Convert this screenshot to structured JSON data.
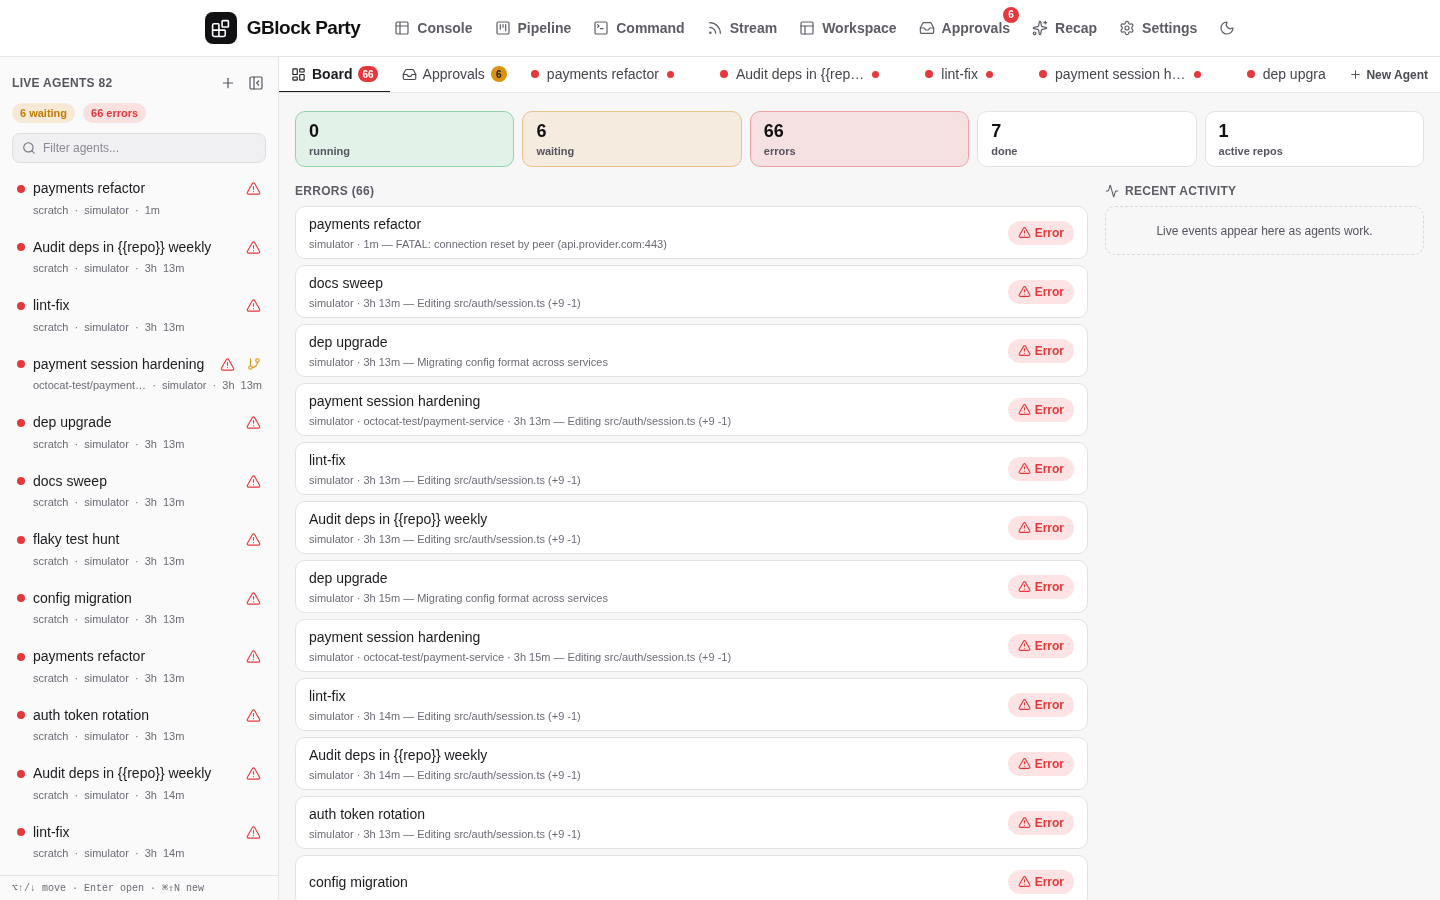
{
  "header": {
    "brand": "GBlock Party",
    "nav": [
      {
        "label": "Console"
      },
      {
        "label": "Pipeline"
      },
      {
        "label": "Command"
      },
      {
        "label": "Stream"
      },
      {
        "label": "Workspace"
      },
      {
        "label": "Approvals",
        "badge": "6"
      },
      {
        "label": "Recap"
      },
      {
        "label": "Settings"
      }
    ]
  },
  "sidebar": {
    "title": "LIVE AGENTS 82",
    "badges": [
      {
        "label": "6 waiting",
        "kind": "warning"
      },
      {
        "label": "66 errors",
        "kind": "danger"
      }
    ],
    "search": {
      "placeholder": "Filter agents..."
    },
    "agents": [
      {
        "name": "payments refactor",
        "meta": "scratch · simulator · 1m",
        "error": true,
        "branch": false
      },
      {
        "name": "Audit deps in {{repo}} weekly",
        "meta": "scratch · simulator · 3h 13m",
        "error": true,
        "branch": false
      },
      {
        "name": "lint-fix",
        "meta": "scratch · simulator · 3h 13m",
        "error": true,
        "branch": false
      },
      {
        "name": "payment session hardening",
        "meta": "octocat-test/payment… · simulator · 3h 13m",
        "error": true,
        "branch": true
      },
      {
        "name": "dep upgrade",
        "meta": "scratch · simulator · 3h 13m",
        "error": true,
        "branch": false
      },
      {
        "name": "docs sweep",
        "meta": "scratch · simulator · 3h 13m",
        "error": true,
        "branch": false
      },
      {
        "name": "flaky test hunt",
        "meta": "scratch · simulator · 3h 13m",
        "error": true,
        "branch": false
      },
      {
        "name": "config migration",
        "meta": "scratch · simulator · 3h 13m",
        "error": true,
        "branch": false
      },
      {
        "name": "payments refactor",
        "meta": "scratch · simulator · 3h 13m",
        "error": true,
        "branch": false
      },
      {
        "name": "auth token rotation",
        "meta": "scratch · simulator · 3h 13m",
        "error": true,
        "branch": false
      },
      {
        "name": "Audit deps in {{repo}} weekly",
        "meta": "scratch · simulator · 3h 14m",
        "error": true,
        "branch": false
      },
      {
        "name": "lint-fix",
        "meta": "scratch · simulator · 3h 14m",
        "error": true,
        "branch": false
      }
    ],
    "footer": "⌥↑/↓ move · Enter open · ⌘⇧N new"
  },
  "tabs": [
    {
      "kind": "board",
      "label": "Board",
      "badge": "66",
      "selected": true
    },
    {
      "kind": "approvals",
      "label": "Approvals",
      "badge": "6",
      "selected": false
    },
    {
      "kind": "agent",
      "label": "payments refactor",
      "error": true,
      "unread": true,
      "selected": false
    },
    {
      "kind": "agent",
      "label": "Audit deps in {{rep…",
      "error": true,
      "unread": true,
      "selected": false
    },
    {
      "kind": "agent",
      "label": "lint-fix",
      "error": true,
      "unread": true,
      "selected": false
    },
    {
      "kind": "agent",
      "label": "payment session h…",
      "error": true,
      "unread": true,
      "selected": false
    },
    {
      "kind": "agent",
      "label": "dep upgra",
      "error": true,
      "unread": false,
      "selected": false
    }
  ],
  "new_agent": "New Agent",
  "stats": [
    {
      "value": "0",
      "label": "running",
      "kind": "success"
    },
    {
      "value": "6",
      "label": "waiting",
      "kind": "warning"
    },
    {
      "value": "66",
      "label": "errors",
      "kind": "danger"
    },
    {
      "value": "7",
      "label": "done",
      "kind": "neutral"
    },
    {
      "value": "1",
      "label": "active repos",
      "kind": "neutral"
    }
  ],
  "errors": {
    "title": "ERRORS (66)",
    "items": [
      {
        "title": "payments refactor",
        "detail": "simulator · 1m — FATAL: connection reset by peer (api.provider.com:443)",
        "badge": "Error"
      },
      {
        "title": "docs sweep",
        "detail": "simulator · 3h 13m — Editing src/auth/session.ts (+9 -1)",
        "badge": "Error"
      },
      {
        "title": "dep upgrade",
        "detail": "simulator · 3h 13m — Migrating config format across services",
        "badge": "Error"
      },
      {
        "title": "payment session hardening",
        "detail": "simulator · octocat-test/payment-service · 3h 13m — Editing src/auth/session.ts (+9 -1)",
        "badge": "Error"
      },
      {
        "title": "lint-fix",
        "detail": "simulator · 3h 13m — Editing src/auth/session.ts (+9 -1)",
        "badge": "Error"
      },
      {
        "title": "Audit deps in {{repo}} weekly",
        "detail": "simulator · 3h 13m — Editing src/auth/session.ts (+9 -1)",
        "badge": "Error"
      },
      {
        "title": "dep upgrade",
        "detail": "simulator · 3h 15m — Migrating config format across services",
        "badge": "Error"
      },
      {
        "title": "payment session hardening",
        "detail": "simulator · octocat-test/payment-service · 3h 15m — Editing src/auth/session.ts (+9 -1)",
        "badge": "Error"
      },
      {
        "title": "lint-fix",
        "detail": "simulator · 3h 14m — Editing src/auth/session.ts (+9 -1)",
        "badge": "Error"
      },
      {
        "title": "Audit deps in {{repo}} weekly",
        "detail": "simulator · 3h 14m — Editing src/auth/session.ts (+9 -1)",
        "badge": "Error"
      },
      {
        "title": "auth token rotation",
        "detail": "simulator · 3h 13m — Editing src/auth/session.ts (+9 -1)",
        "badge": "Error"
      },
      {
        "title": "config migration",
        "badge": "Error"
      }
    ]
  },
  "activity": {
    "title": "RECENT ACTIVITY",
    "empty": "Live events appear here as agents work."
  }
}
